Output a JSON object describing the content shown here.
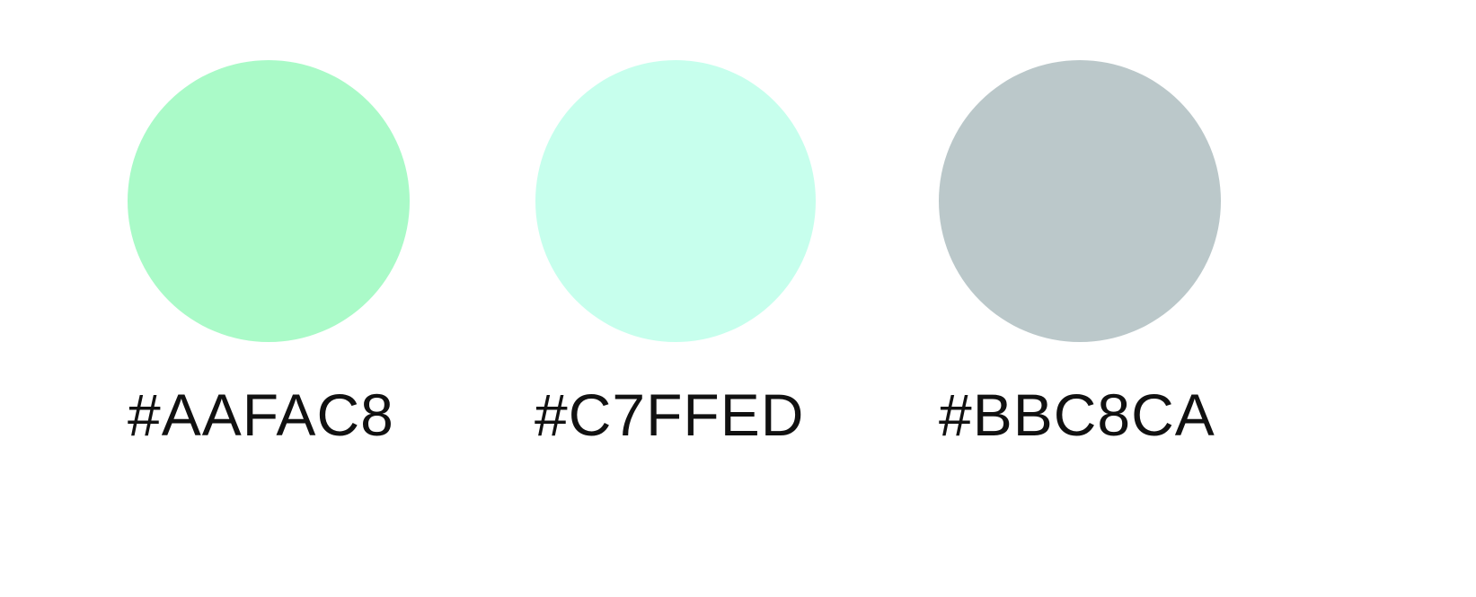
{
  "swatches": [
    {
      "hex_label": "#AAFAC8",
      "color": "#AAFAC8"
    },
    {
      "hex_label": "#C7FFED",
      "color": "#C7FFED"
    },
    {
      "hex_label": "#BBC8CA",
      "color": "#BBC8CA"
    }
  ]
}
